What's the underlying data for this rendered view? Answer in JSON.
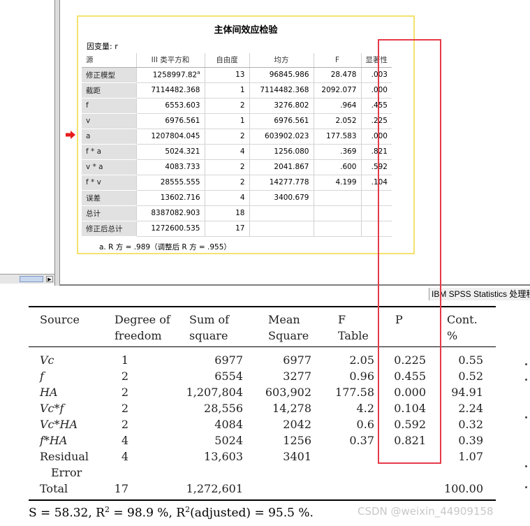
{
  "spss": {
    "title": "主体间效应检验",
    "dependent": "因变量:   r",
    "headers": [
      "源",
      "III 类平方和",
      "自由度",
      "均方",
      "F",
      "显著性"
    ],
    "rows": [
      {
        "source": "修正模型",
        "ss": "1258997.82",
        "ss_sup": "a",
        "df": "13",
        "ms": "96845.986",
        "f": "28.478",
        "sig": ".003"
      },
      {
        "source": "截距",
        "ss": "7114482.368",
        "ss_sup": "",
        "df": "1",
        "ms": "7114482.368",
        "f": "2092.077",
        "sig": ".000"
      },
      {
        "source": "f",
        "ss": "6553.603",
        "ss_sup": "",
        "df": "2",
        "ms": "3276.802",
        "f": ".964",
        "sig": ".455"
      },
      {
        "source": "v",
        "ss": "6976.561",
        "ss_sup": "",
        "df": "1",
        "ms": "6976.561",
        "f": "2.052",
        "sig": ".225"
      },
      {
        "source": "a",
        "ss": "1207804.045",
        "ss_sup": "",
        "df": "2",
        "ms": "603902.023",
        "f": "177.583",
        "sig": ".000"
      },
      {
        "source": "f * a",
        "ss": "5024.321",
        "ss_sup": "",
        "df": "4",
        "ms": "1256.080",
        "f": ".369",
        "sig": ".821"
      },
      {
        "source": "v * a",
        "ss": "4083.733",
        "ss_sup": "",
        "df": "2",
        "ms": "2041.867",
        "f": ".600",
        "sig": ".592"
      },
      {
        "source": "f * v",
        "ss": "28555.555",
        "ss_sup": "",
        "df": "2",
        "ms": "14277.778",
        "f": "4.199",
        "sig": ".104"
      },
      {
        "source": "误差",
        "ss": "13602.716",
        "ss_sup": "",
        "df": "4",
        "ms": "3400.679",
        "f": "",
        "sig": ""
      },
      {
        "source": "总计",
        "ss": "8387082.903",
        "ss_sup": "",
        "df": "18",
        "ms": "",
        "f": "",
        "sig": ""
      },
      {
        "source": "修正后总计",
        "ss": "1272600.535",
        "ss_sup": "",
        "df": "17",
        "ms": "",
        "f": "",
        "sig": ""
      }
    ],
    "footnote": "a. R 方 = .989（调整后 R 方 = .955）"
  },
  "status_bar": {
    "text": "IBM SPSS Statistics 处理程序"
  },
  "paper": {
    "headers": {
      "source": "Source",
      "dof": [
        "Degree of",
        "freedom"
      ],
      "ss": [
        "Sum of",
        "square"
      ],
      "ms": [
        "Mean",
        "Square"
      ],
      "f": [
        "F",
        "Table"
      ],
      "p": "P",
      "cont": [
        "Cont.",
        "%"
      ]
    },
    "rows": [
      {
        "source": "Vc",
        "italic": true,
        "dof": "1",
        "ss": "6977",
        "ms": "6977",
        "f": "2.05",
        "p": "0.225",
        "cont": "0.55"
      },
      {
        "source": "f",
        "italic": true,
        "dof": "2",
        "ss": "6554",
        "ms": "3277",
        "f": "0.96",
        "p": "0.455",
        "cont": "0.52"
      },
      {
        "source": "HA",
        "italic": true,
        "dof": "2",
        "ss": "1,207,804",
        "ms": "603,902",
        "f": "177.58",
        "p": "0.000",
        "cont": "94.91"
      },
      {
        "source": "Vc*f",
        "italic": true,
        "dof": "2",
        "ss": "28,556",
        "ms": "14,278",
        "f": "4.2",
        "p": "0.104",
        "cont": "2.24"
      },
      {
        "source": "Vc*HA",
        "italic": true,
        "dof": "2",
        "ss": "4084",
        "ms": "2042",
        "f": "0.6",
        "p": "0.592",
        "cont": "0.32"
      },
      {
        "source": "f*HA",
        "italic": true,
        "dof": "4",
        "ss": "5024",
        "ms": "1256",
        "f": "0.37",
        "p": "0.821",
        "cont": "0.39"
      },
      {
        "source": "Residual",
        "source2": "Error",
        "italic": false,
        "dof": "4",
        "ss": "13,603",
        "ms": "3401",
        "f": "",
        "p": "",
        "cont": "1.07"
      },
      {
        "source": "Total",
        "italic": false,
        "dof": "17",
        "ss": "1,272,601",
        "ms": "",
        "f": "",
        "p": "",
        "cont": "100.00"
      }
    ],
    "caption": {
      "s": "S = 58.32, R",
      "sup1": "2",
      "mid": " = 98.9 %, R",
      "sup2": "2",
      "end": "(adjusted) = 95.5 %."
    }
  },
  "watermark": "CSDN @weixin_44909158",
  "colors": {
    "highlight": "#e53a4a",
    "frame": "#f4e26e",
    "arrow": "#e81c1c",
    "row_header_bg": "#e1e1e1"
  }
}
